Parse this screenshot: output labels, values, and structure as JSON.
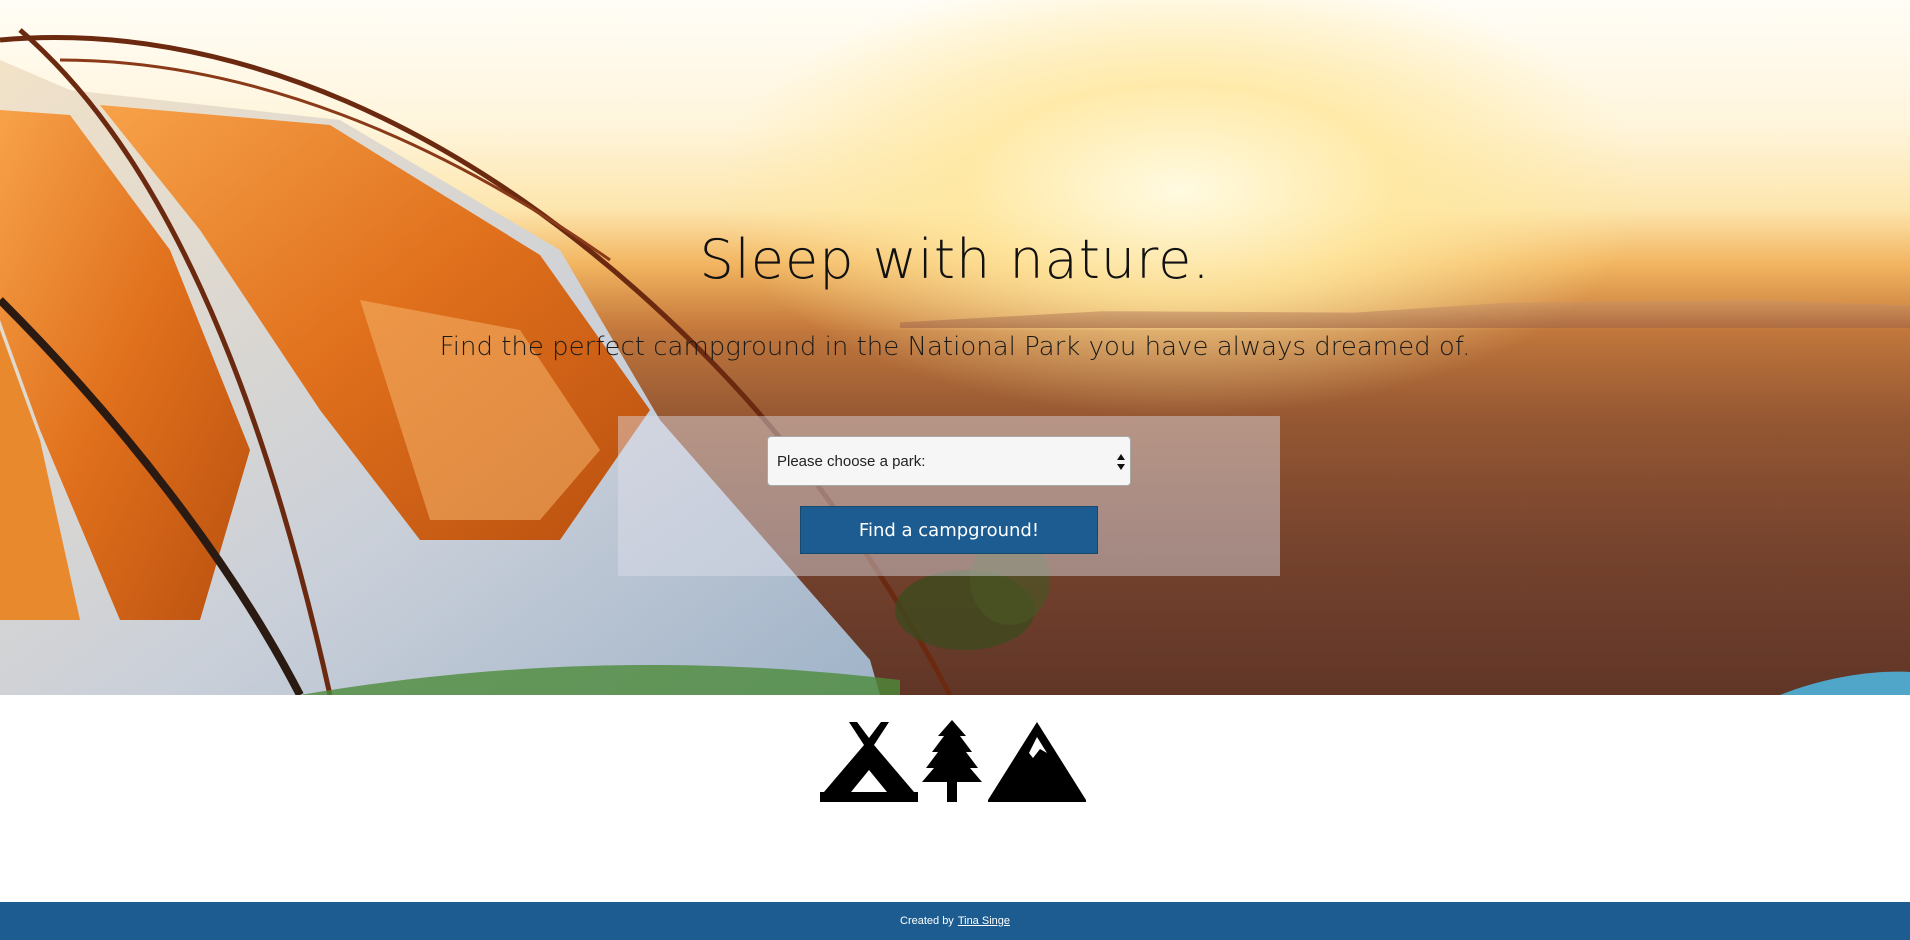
{
  "hero": {
    "title": "Sleep with nature.",
    "subtitle": "Find the perfect campground in the National Park you have always dreamed of."
  },
  "search": {
    "select_value": "Please choose a park:",
    "button_label": "Find a campground!"
  },
  "icons": [
    "campground-icon",
    "tree-icon",
    "mountain-icon"
  ],
  "footer": {
    "prefix": "Created by",
    "author_link": "Tina Singe"
  },
  "colors": {
    "brand_blue": "#1c5c91",
    "text_dark": "#111111",
    "footer_text": "#ffffff"
  }
}
